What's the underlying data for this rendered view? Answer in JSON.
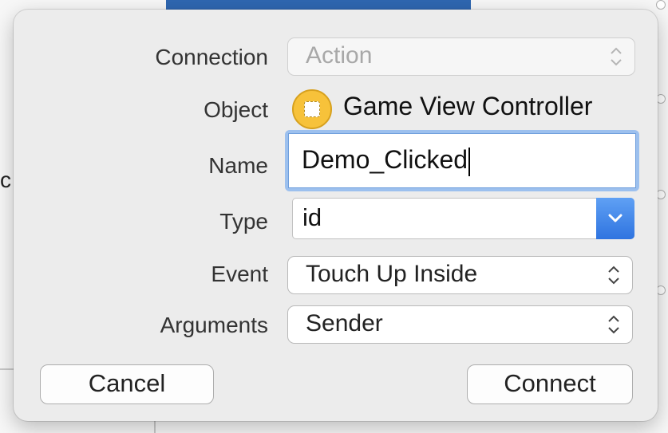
{
  "dialog": {
    "connection": {
      "label": "Connection",
      "value": "Action"
    },
    "object": {
      "label": "Object",
      "value": "Game View Controller"
    },
    "name": {
      "label": "Name",
      "value": "Demo_Clicked"
    },
    "type": {
      "label": "Type",
      "value": "id"
    },
    "event": {
      "label": "Event",
      "value": "Touch Up Inside"
    },
    "arguments": {
      "label": "Arguments",
      "value": "Sender"
    },
    "buttons": {
      "cancel": "Cancel",
      "connect": "Connect"
    }
  },
  "background": {
    "partial_text": "c"
  },
  "colors": {
    "accent": "#2f74e0",
    "object_icon": "#f7c23a",
    "popover_bg": "#ececec"
  },
  "icons": [
    "updown-arrows-icon",
    "chevron-down-icon",
    "view-controller-icon"
  ]
}
